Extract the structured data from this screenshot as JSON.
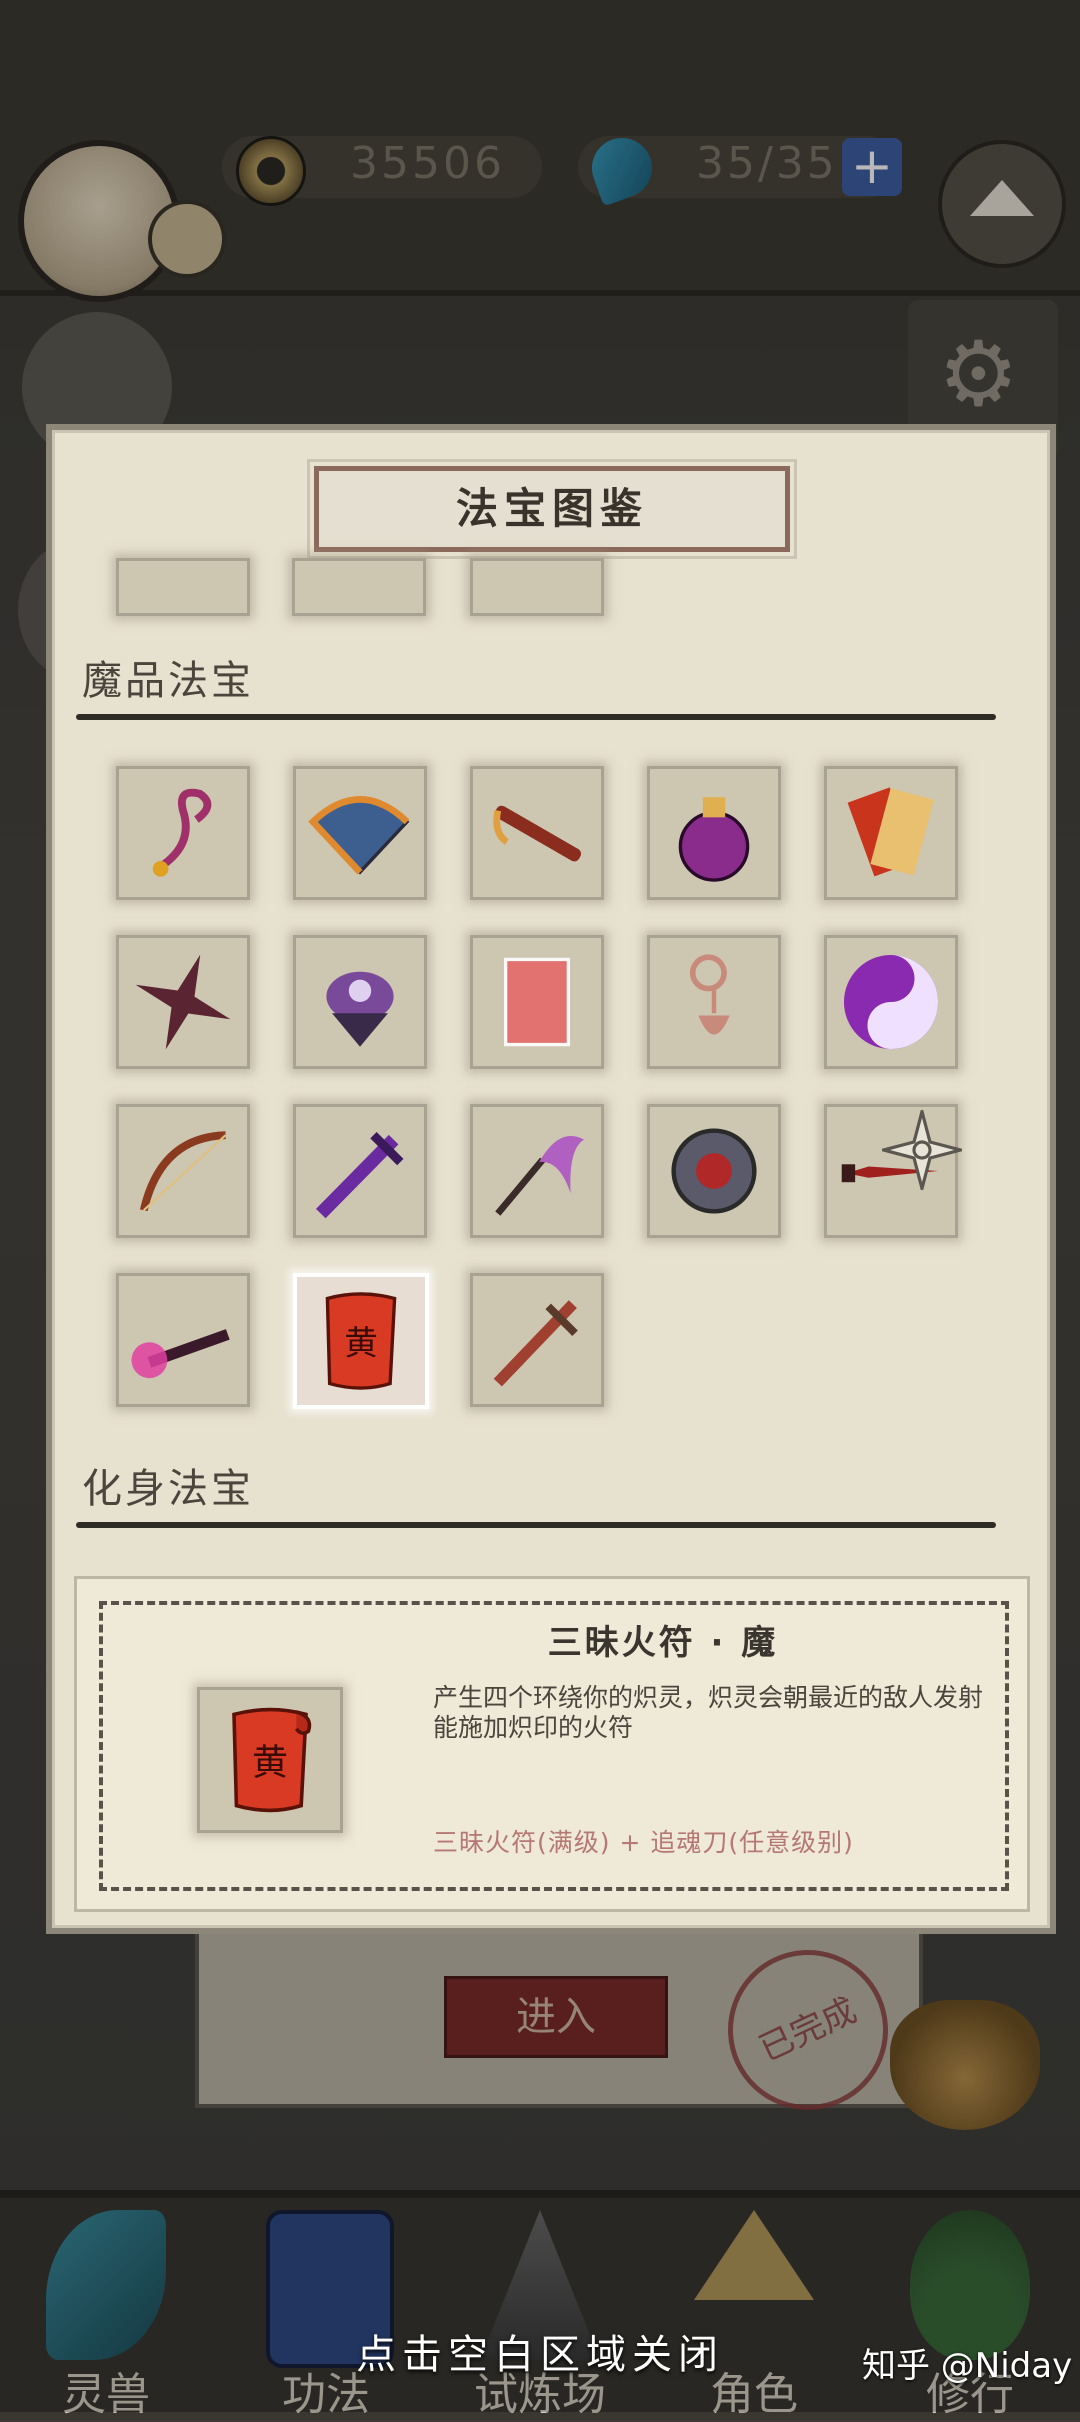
{
  "hud": {
    "coins": "35506",
    "stamina": "35/35",
    "plus_label": "+"
  },
  "modal": {
    "title": "法宝图鉴",
    "section_demon": "魔品法宝",
    "section_avatar": "化身法宝",
    "demon_items": [
      {
        "icon": "hairpin-icon",
        "color": "#a0306a"
      },
      {
        "icon": "war-fan-icon",
        "color": "#3d5f8f"
      },
      {
        "icon": "flute-icon",
        "color": "#8a2c1e"
      },
      {
        "icon": "gourd-potion-icon",
        "color": "#8a2c8c"
      },
      {
        "icon": "burning-talisman-icon",
        "color": "#c8341c"
      },
      {
        "icon": "shuriken-icon",
        "color": "#5a2432"
      },
      {
        "icon": "purple-lotus-icon",
        "color": "#7a4a9a"
      },
      {
        "icon": "glowing-scroll-icon",
        "color": "#e46a6a"
      },
      {
        "icon": "cloud-pendant-icon",
        "color": "#c88a7a"
      },
      {
        "icon": "yin-yang-icon",
        "color": "#8a2ab0"
      },
      {
        "icon": "bow-icon",
        "color": "#8a3a1e"
      },
      {
        "icon": "purple-sword-icon",
        "color": "#6a2aa0"
      },
      {
        "icon": "scythe-icon",
        "color": "#b060c0"
      },
      {
        "icon": "red-gem-ring-icon",
        "color": "#b02828"
      },
      {
        "icon": "dagger-icon",
        "color": "#a0201e"
      },
      {
        "icon": "fire-torch-icon",
        "color": "#e040a0"
      },
      {
        "icon": "fire-talisman-scroll-icon",
        "color": "#d83a24",
        "selected": true
      },
      {
        "icon": "bronze-sword-icon",
        "color": "#a04030"
      }
    ]
  },
  "detail": {
    "name": "三昧火符 · 魔",
    "description": "产生四个环绕你的炽灵，炽灵会朝最近的敌人发射能施加炽印的火符",
    "recipe": "三昧火符(满级) + 追魂刀(任意级别)"
  },
  "background": {
    "enter_button": "进入",
    "done_stamp": "已完成"
  },
  "bottom_nav": [
    {
      "label": "灵兽",
      "icon": "feather-icon"
    },
    {
      "label": "功法",
      "icon": "book-icon"
    },
    {
      "label": "试炼场",
      "icon": "mountain-icon"
    },
    {
      "label": "角色",
      "icon": "straw-hat-icon"
    },
    {
      "label": "修行",
      "icon": "gourd-icon"
    }
  ],
  "footer": {
    "close_hint": "点击空白区域关闭",
    "watermark": "知乎 @Niday"
  }
}
